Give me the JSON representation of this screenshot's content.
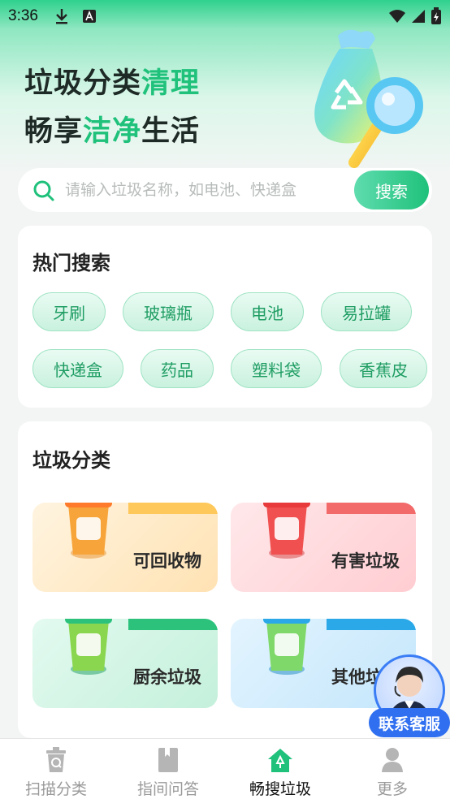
{
  "status_bar": {
    "time": "3:36"
  },
  "hero": {
    "line1_prefix": "垃圾分类",
    "line1_accent": "清理",
    "line2_prefix": "畅享",
    "line2_accent": "洁净",
    "line2_suffix": "生活"
  },
  "search": {
    "placeholder": "请输入垃圾名称，如电池、快递盒",
    "value": "",
    "button_label": "搜索"
  },
  "hot_search": {
    "title": "热门搜索",
    "chips": [
      "牙刷",
      "玻璃瓶",
      "电池",
      "易拉罐",
      "快递盒",
      "药品",
      "塑料袋",
      "香蕉皮"
    ]
  },
  "categories": {
    "title": "垃圾分类",
    "items": [
      {
        "label": "可回收物",
        "can_text": "可回收物",
        "color": "#f7a53a"
      },
      {
        "label": "有害垃圾",
        "can_text": "有害垃圾",
        "color": "#f0504f"
      },
      {
        "label": "厨余垃圾",
        "can_text": "厨余垃圾",
        "color": "#2cc27c"
      },
      {
        "label": "其他垃圾",
        "can_text": "其他垃圾",
        "color": "#2aa8e8"
      }
    ]
  },
  "customer_service": {
    "label": "联系客服"
  },
  "bottom_nav": {
    "items": [
      {
        "label": "扫描分类",
        "icon": "scan-bin-icon"
      },
      {
        "label": "指间问答",
        "icon": "book-icon"
      },
      {
        "label": "畅搜垃圾",
        "icon": "home-recycle-icon"
      },
      {
        "label": "更多",
        "icon": "user-icon"
      }
    ],
    "active_index": 2
  },
  "colors": {
    "accent": "#1fc17b",
    "chip_text": "#1f9d63",
    "cs_blue": "#2f6ff0"
  }
}
